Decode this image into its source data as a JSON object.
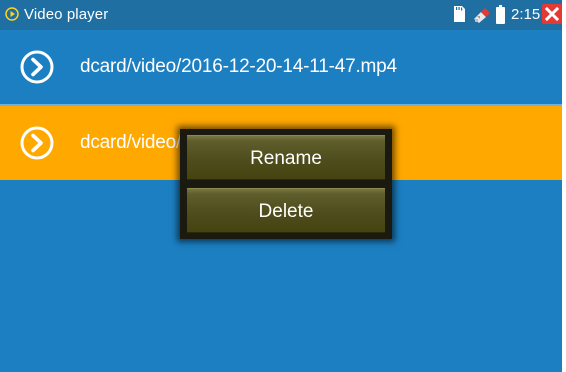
{
  "status_bar": {
    "title": "Video player",
    "time": "2:15 PM",
    "bg_color": "#1f6fa3",
    "icons": [
      "play-circle-icon",
      "sd-card-icon",
      "usb-icon",
      "battery-icon",
      "close-icon"
    ]
  },
  "files": [
    {
      "path": "dcard/video/2016-12-20-14-11-47.mp4",
      "selected": false
    },
    {
      "path": "dcard/video/",
      "selected": true
    }
  ],
  "context_menu": {
    "rename_label": "Rename",
    "delete_label": "Delete"
  },
  "colors": {
    "list_bg": "#1b7fc2",
    "selected_bg": "#ffa800",
    "close_red": "#e53935",
    "menu_olive": "#5e5d2b"
  }
}
